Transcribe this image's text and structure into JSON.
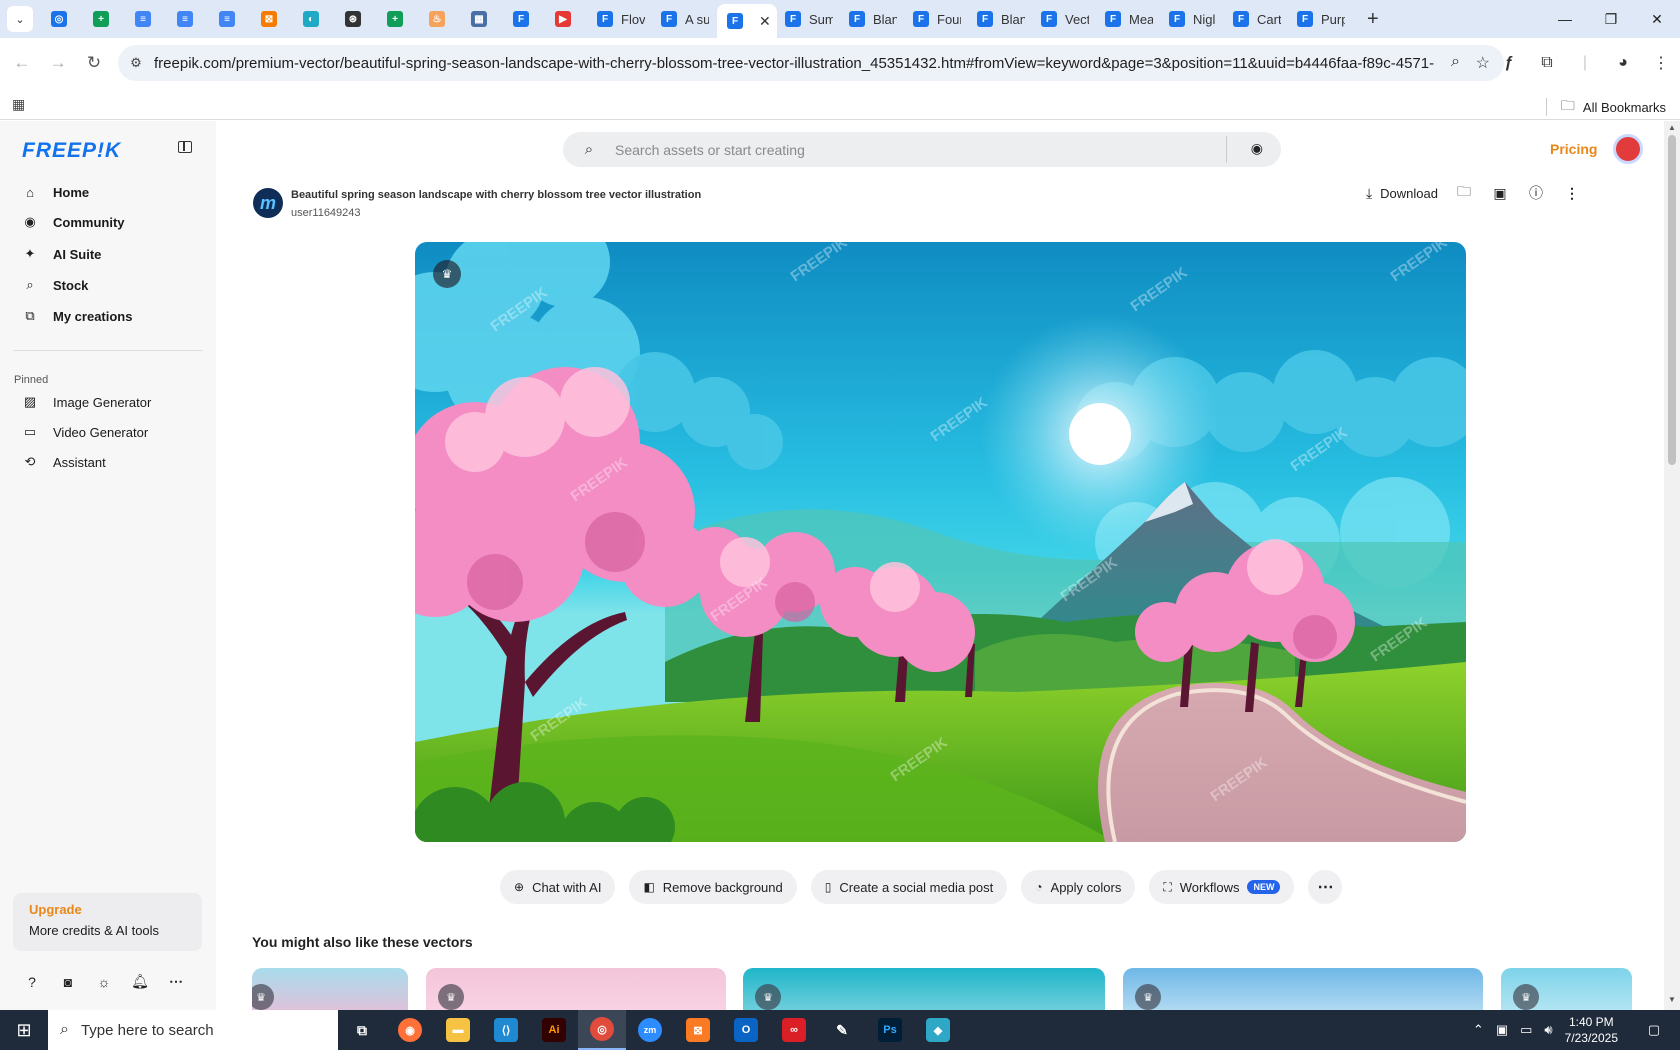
{
  "browser": {
    "tabs": [
      {
        "icon_color": "#1a73e8",
        "icon": "◎",
        "label": ""
      },
      {
        "icon_color": "#0f9d58",
        "icon": "+",
        "label": ""
      },
      {
        "icon_color": "#4285f4",
        "icon": "≡",
        "label": ""
      },
      {
        "icon_color": "#4285f4",
        "icon": "≡",
        "label": ""
      },
      {
        "icon_color": "#4285f4",
        "icon": "≡",
        "label": ""
      },
      {
        "icon_color": "#f57c00",
        "icon": "⊠",
        "label": ""
      },
      {
        "icon_color": "#1fa9c4",
        "icon": "◐",
        "label": ""
      },
      {
        "icon_color": "#333333",
        "icon": "⊛",
        "label": ""
      },
      {
        "icon_color": "#0f9d58",
        "icon": "+",
        "label": ""
      },
      {
        "icon_color": "#f5a25d",
        "icon": "♨",
        "label": ""
      },
      {
        "icon_color": "#4a6fa5",
        "icon": "▦",
        "label": ""
      },
      {
        "icon_color": "#1a73e8",
        "icon": "F",
        "label": ""
      },
      {
        "icon_color": "#e53935",
        "icon": "▶",
        "label": ""
      },
      {
        "icon_color": "#1a73e8",
        "icon": "F",
        "label": "Flov"
      },
      {
        "icon_color": "#1a73e8",
        "icon": "F",
        "label": "A su"
      },
      {
        "icon_color": "#1a73e8",
        "icon": "F",
        "label": "",
        "active": true
      },
      {
        "icon_color": "#1a73e8",
        "icon": "F",
        "label": "Sum"
      },
      {
        "icon_color": "#1a73e8",
        "icon": "F",
        "label": "Blan"
      },
      {
        "icon_color": "#1a73e8",
        "icon": "F",
        "label": "Four"
      },
      {
        "icon_color": "#1a73e8",
        "icon": "F",
        "label": "Blan"
      },
      {
        "icon_color": "#1a73e8",
        "icon": "F",
        "label": "Vect"
      },
      {
        "icon_color": "#1a73e8",
        "icon": "F",
        "label": "Mea"
      },
      {
        "icon_color": "#1a73e8",
        "icon": "F",
        "label": "Nigl"
      },
      {
        "icon_color": "#1a73e8",
        "icon": "F",
        "label": "Cart"
      },
      {
        "icon_color": "#1a73e8",
        "icon": "F",
        "label": "Purp"
      }
    ],
    "url": "freepik.com/premium-vector/beautiful-spring-season-landscape-with-cherry-blossom-tree-vector-illustration_45351432.htm#fromView=keyword&page=3&position=11&uuid=b4446faa-f89c-4571-99c7-...",
    "all_bookmarks": "All Bookmarks"
  },
  "sidebar": {
    "logo": "FREEP!K",
    "nav": [
      {
        "icon": "⌂",
        "label": "Home"
      },
      {
        "icon": "◉",
        "label": "Community"
      },
      {
        "icon": "✦",
        "label": "AI Suite"
      },
      {
        "icon": "⌕",
        "label": "Stock"
      },
      {
        "icon": "⧉",
        "label": "My creations"
      }
    ],
    "pinned_label": "Pinned",
    "pinned": [
      {
        "icon": "▨",
        "label": "Image Generator"
      },
      {
        "icon": "▭",
        "label": "Video Generator"
      },
      {
        "icon": "⟲",
        "label": "Assistant"
      }
    ],
    "upgrade_title": "Upgrade",
    "upgrade_sub": "More credits & AI tools"
  },
  "header": {
    "search_placeholder": "Search assets or start creating",
    "pricing": "Pricing"
  },
  "asset": {
    "title": "Beautiful spring season landscape with cherry blossom tree vector illustration",
    "author": "user11649243",
    "download": "Download",
    "watermark": "FREEPIK"
  },
  "chips": [
    {
      "icon": "⊕",
      "label": "Chat with AI"
    },
    {
      "icon": "◧",
      "label": "Remove background"
    },
    {
      "icon": "▯",
      "label": "Create a social media post"
    },
    {
      "icon": "◔",
      "label": "Apply colors"
    },
    {
      "icon": "⛶",
      "label": "Workflows",
      "badge": "NEW"
    }
  ],
  "related_title": "You might also like these vectors",
  "taskbar": {
    "search_placeholder": "Type here to search",
    "time": "1:40 PM",
    "date": "7/23/2025"
  },
  "colors": {
    "brand_blue": "#1273eb",
    "accent_orange": "#e8881a",
    "new_badge": "#2563eb"
  }
}
